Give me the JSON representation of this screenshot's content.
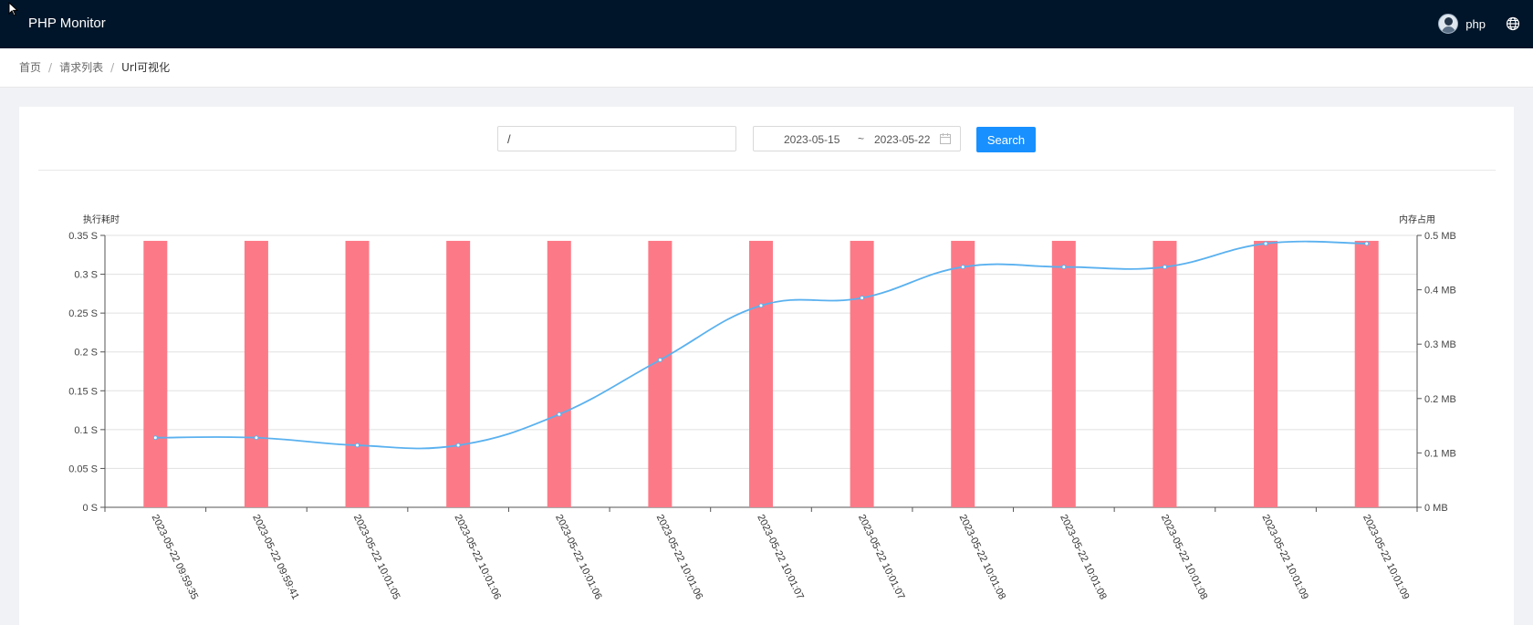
{
  "app": {
    "title": "PHP Monitor"
  },
  "user": {
    "name": "php",
    "avatar_icon": "user-avatar",
    "language_icon": "globe-icon"
  },
  "breadcrumb": {
    "items": [
      "首页",
      "请求列表",
      "Url可视化"
    ],
    "separator": "/"
  },
  "filters": {
    "url_value": "/",
    "date_start": "2023-05-15",
    "date_separator": "~",
    "date_end": "2023-05-22",
    "calendar_icon": "calendar-icon",
    "search_label": "Search"
  },
  "colors": {
    "header_bg": "#001529",
    "primary": "#1890ff",
    "bar": "#fc7a87",
    "line": "#5ab1ef"
  },
  "chart_data": {
    "type": "bar",
    "categories": [
      "2023-05-22 09:59:35",
      "2023-05-22 09:59:41",
      "2023-05-22 10:01:05",
      "2023-05-22 10:01:06",
      "2023-05-22 10:01:06",
      "2023-05-22 10:01:06",
      "2023-05-22 10:01:07",
      "2023-05-22 10:01:07",
      "2023-05-22 10:01:08",
      "2023-05-22 10:01:08",
      "2023-05-22 10:01:08",
      "2023-05-22 10:01:09",
      "2023-05-22 10:01:09"
    ],
    "series": [
      {
        "name": "执行耗时",
        "type": "bar",
        "axis": "left",
        "values": [
          0.343,
          0.343,
          0.343,
          0.343,
          0.343,
          0.343,
          0.343,
          0.343,
          0.343,
          0.343,
          0.343,
          0.343,
          0.343
        ]
      },
      {
        "name": "内存占用",
        "type": "line",
        "smooth": true,
        "axis": "right",
        "values": [
          0.128,
          0.128,
          0.114,
          0.114,
          0.171,
          0.271,
          0.371,
          0.385,
          0.442,
          0.442,
          0.442,
          0.485,
          0.485
        ]
      }
    ],
    "y_left": {
      "label": "执行耗时",
      "min": 0,
      "max": 0.35,
      "ticks": [
        "0 S",
        "0.05 S",
        "0.1 S",
        "0.15 S",
        "0.2 S",
        "0.25 S",
        "0.3 S",
        "0.35 S"
      ]
    },
    "y_right": {
      "label": "内存占用",
      "min": 0,
      "max": 0.5,
      "ticks": [
        "0 MB",
        "0.1 MB",
        "0.2 MB",
        "0.3 MB",
        "0.4 MB",
        "0.5 MB"
      ]
    },
    "grid": true,
    "legend": "none"
  }
}
